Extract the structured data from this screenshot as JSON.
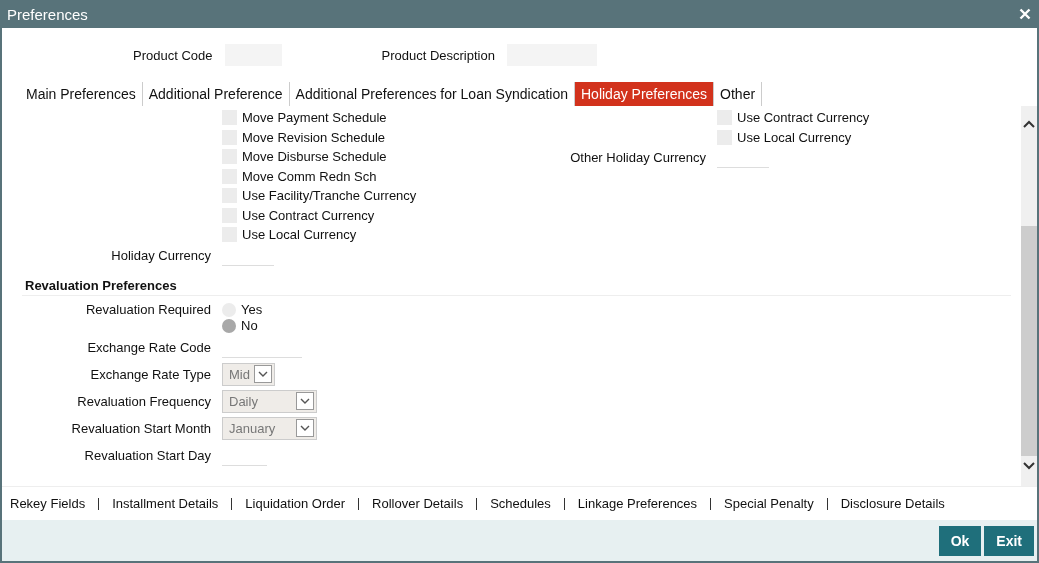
{
  "window": {
    "title": "Preferences"
  },
  "header_fields": [
    {
      "label": "Product Code",
      "kind": "short"
    },
    {
      "label": "Product Description",
      "kind": "long"
    }
  ],
  "tabs": [
    {
      "label": "Main Preferences",
      "selected": false
    },
    {
      "label": "Additional Preference",
      "selected": false
    },
    {
      "label": "Additional Preferences for Loan Syndication",
      "selected": false
    },
    {
      "label": "Holiday Preferences",
      "selected": true
    },
    {
      "label": "Other",
      "selected": false
    }
  ],
  "holiday": {
    "left_options": [
      {
        "label": "Move Payment Schedule",
        "checked": false
      },
      {
        "label": "Move Revision Schedule",
        "checked": false
      },
      {
        "label": "Move Disburse Schedule",
        "checked": false
      },
      {
        "label": "Move Comm Redn Sch",
        "checked": false
      },
      {
        "label": "Use Facility/Tranche Currency",
        "checked": false
      },
      {
        "label": "Use Contract Currency",
        "checked": false
      },
      {
        "label": "Use Local Currency",
        "checked": false
      }
    ],
    "holiday_currency": {
      "label": "Holiday Currency"
    },
    "right_options": [
      {
        "label": "Use Contract Currency",
        "checked": false
      },
      {
        "label": "Use Local Currency",
        "checked": false
      }
    ],
    "other_holiday_currency": {
      "label": "Other Holiday Currency"
    }
  },
  "revaluation": {
    "title": "Revaluation Preferences",
    "required": {
      "label": "Revaluation Required",
      "options": [
        {
          "label": "Yes",
          "selected": false
        },
        {
          "label": "No",
          "selected": true
        }
      ]
    },
    "exchange_rate_code": {
      "label": "Exchange Rate Code"
    },
    "selects": [
      {
        "label": "Exchange Rate Type",
        "value": "Mid",
        "kind": "short"
      },
      {
        "label": "Revaluation Frequency",
        "value": "Daily",
        "kind": "long"
      },
      {
        "label": "Revaluation Start Month",
        "value": "January",
        "kind": "long"
      }
    ],
    "start_day": {
      "label": "Revaluation Start Day"
    }
  },
  "links": [
    "Rekey Fields",
    "Installment Details",
    "Liquidation Order",
    "Rollover Details",
    "Schedules",
    "Linkage Preferences",
    "Special Penalty",
    "Disclosure Details"
  ],
  "buttons": [
    "Ok",
    "Exit"
  ]
}
